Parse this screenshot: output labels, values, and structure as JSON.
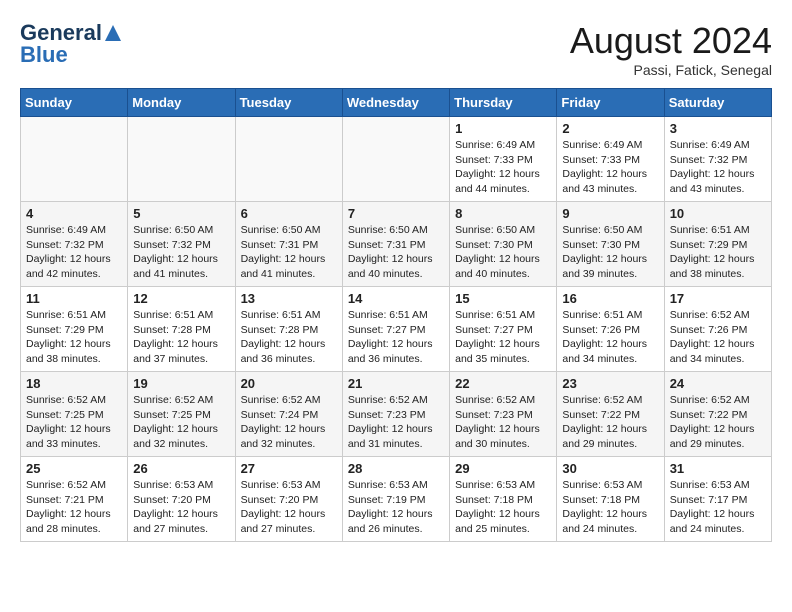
{
  "logo": {
    "general": "General",
    "blue": "Blue"
  },
  "title": "August 2024",
  "subtitle": "Passi, Fatick, Senegal",
  "days_of_week": [
    "Sunday",
    "Monday",
    "Tuesday",
    "Wednesday",
    "Thursday",
    "Friday",
    "Saturday"
  ],
  "weeks": [
    [
      {
        "day": "",
        "info": ""
      },
      {
        "day": "",
        "info": ""
      },
      {
        "day": "",
        "info": ""
      },
      {
        "day": "",
        "info": ""
      },
      {
        "day": "1",
        "info": "Sunrise: 6:49 AM\nSunset: 7:33 PM\nDaylight: 12 hours\nand 44 minutes."
      },
      {
        "day": "2",
        "info": "Sunrise: 6:49 AM\nSunset: 7:33 PM\nDaylight: 12 hours\nand 43 minutes."
      },
      {
        "day": "3",
        "info": "Sunrise: 6:49 AM\nSunset: 7:32 PM\nDaylight: 12 hours\nand 43 minutes."
      }
    ],
    [
      {
        "day": "4",
        "info": "Sunrise: 6:49 AM\nSunset: 7:32 PM\nDaylight: 12 hours\nand 42 minutes."
      },
      {
        "day": "5",
        "info": "Sunrise: 6:50 AM\nSunset: 7:32 PM\nDaylight: 12 hours\nand 41 minutes."
      },
      {
        "day": "6",
        "info": "Sunrise: 6:50 AM\nSunset: 7:31 PM\nDaylight: 12 hours\nand 41 minutes."
      },
      {
        "day": "7",
        "info": "Sunrise: 6:50 AM\nSunset: 7:31 PM\nDaylight: 12 hours\nand 40 minutes."
      },
      {
        "day": "8",
        "info": "Sunrise: 6:50 AM\nSunset: 7:30 PM\nDaylight: 12 hours\nand 40 minutes."
      },
      {
        "day": "9",
        "info": "Sunrise: 6:50 AM\nSunset: 7:30 PM\nDaylight: 12 hours\nand 39 minutes."
      },
      {
        "day": "10",
        "info": "Sunrise: 6:51 AM\nSunset: 7:29 PM\nDaylight: 12 hours\nand 38 minutes."
      }
    ],
    [
      {
        "day": "11",
        "info": "Sunrise: 6:51 AM\nSunset: 7:29 PM\nDaylight: 12 hours\nand 38 minutes."
      },
      {
        "day": "12",
        "info": "Sunrise: 6:51 AM\nSunset: 7:28 PM\nDaylight: 12 hours\nand 37 minutes."
      },
      {
        "day": "13",
        "info": "Sunrise: 6:51 AM\nSunset: 7:28 PM\nDaylight: 12 hours\nand 36 minutes."
      },
      {
        "day": "14",
        "info": "Sunrise: 6:51 AM\nSunset: 7:27 PM\nDaylight: 12 hours\nand 36 minutes."
      },
      {
        "day": "15",
        "info": "Sunrise: 6:51 AM\nSunset: 7:27 PM\nDaylight: 12 hours\nand 35 minutes."
      },
      {
        "day": "16",
        "info": "Sunrise: 6:51 AM\nSunset: 7:26 PM\nDaylight: 12 hours\nand 34 minutes."
      },
      {
        "day": "17",
        "info": "Sunrise: 6:52 AM\nSunset: 7:26 PM\nDaylight: 12 hours\nand 34 minutes."
      }
    ],
    [
      {
        "day": "18",
        "info": "Sunrise: 6:52 AM\nSunset: 7:25 PM\nDaylight: 12 hours\nand 33 minutes."
      },
      {
        "day": "19",
        "info": "Sunrise: 6:52 AM\nSunset: 7:25 PM\nDaylight: 12 hours\nand 32 minutes."
      },
      {
        "day": "20",
        "info": "Sunrise: 6:52 AM\nSunset: 7:24 PM\nDaylight: 12 hours\nand 32 minutes."
      },
      {
        "day": "21",
        "info": "Sunrise: 6:52 AM\nSunset: 7:23 PM\nDaylight: 12 hours\nand 31 minutes."
      },
      {
        "day": "22",
        "info": "Sunrise: 6:52 AM\nSunset: 7:23 PM\nDaylight: 12 hours\nand 30 minutes."
      },
      {
        "day": "23",
        "info": "Sunrise: 6:52 AM\nSunset: 7:22 PM\nDaylight: 12 hours\nand 29 minutes."
      },
      {
        "day": "24",
        "info": "Sunrise: 6:52 AM\nSunset: 7:22 PM\nDaylight: 12 hours\nand 29 minutes."
      }
    ],
    [
      {
        "day": "25",
        "info": "Sunrise: 6:52 AM\nSunset: 7:21 PM\nDaylight: 12 hours\nand 28 minutes."
      },
      {
        "day": "26",
        "info": "Sunrise: 6:53 AM\nSunset: 7:20 PM\nDaylight: 12 hours\nand 27 minutes."
      },
      {
        "day": "27",
        "info": "Sunrise: 6:53 AM\nSunset: 7:20 PM\nDaylight: 12 hours\nand 27 minutes."
      },
      {
        "day": "28",
        "info": "Sunrise: 6:53 AM\nSunset: 7:19 PM\nDaylight: 12 hours\nand 26 minutes."
      },
      {
        "day": "29",
        "info": "Sunrise: 6:53 AM\nSunset: 7:18 PM\nDaylight: 12 hours\nand 25 minutes."
      },
      {
        "day": "30",
        "info": "Sunrise: 6:53 AM\nSunset: 7:18 PM\nDaylight: 12 hours\nand 24 minutes."
      },
      {
        "day": "31",
        "info": "Sunrise: 6:53 AM\nSunset: 7:17 PM\nDaylight: 12 hours\nand 24 minutes."
      }
    ]
  ]
}
